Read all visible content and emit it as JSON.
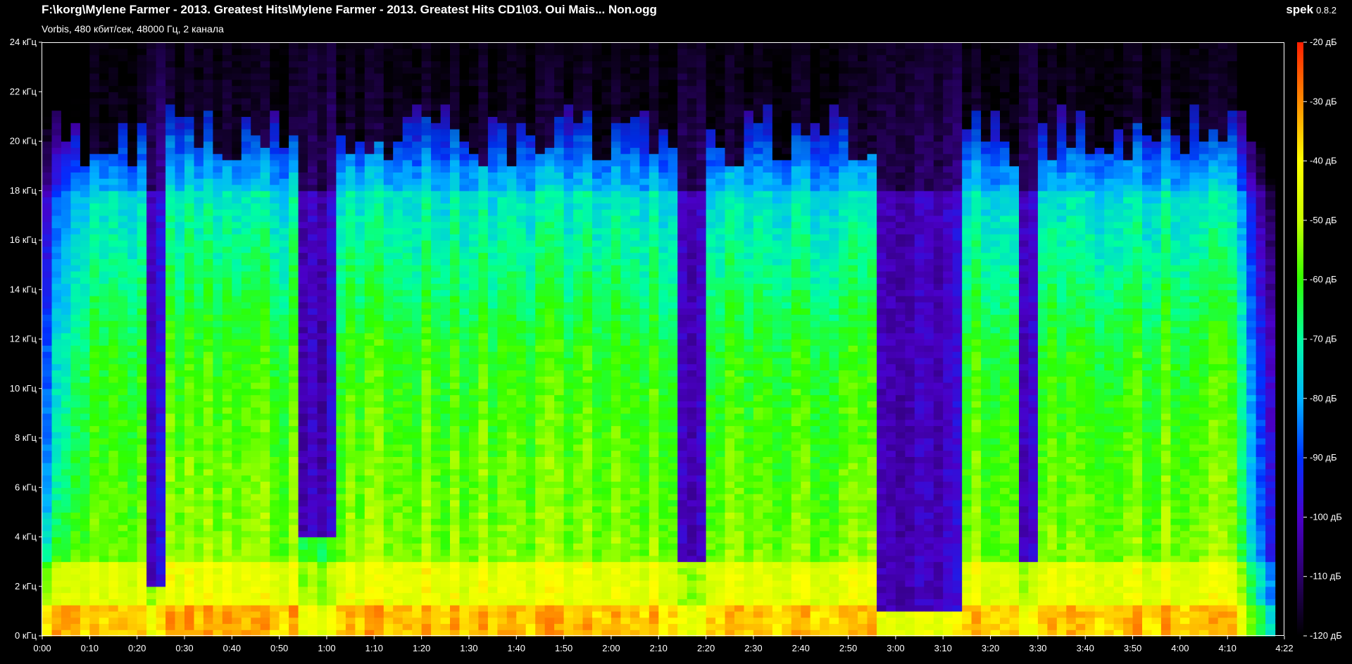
{
  "app": {
    "name": "spek",
    "version": "0.8.2"
  },
  "header": {
    "file_path": "F:\\korg\\Mylene Farmer - 2013. Greatest Hits\\Mylene Farmer - 2013. Greatest Hits CD1\\03. Oui Mais... Non.ogg",
    "file_info": "Vorbis, 480 кбит/сек, 48000 Гц, 2 канала"
  },
  "colors": {
    "background": "#000000",
    "axis": "#ffffff",
    "palette": [
      "#000000",
      "#2a0066",
      "#4a00c8",
      "#0030ff",
      "#00b4ff",
      "#00ffa0",
      "#30ff00",
      "#c8ff00",
      "#ffff00",
      "#ff8c00",
      "#ff1e00"
    ]
  },
  "chart_data": {
    "type": "heatmap",
    "title": "F:\\korg\\Mylene Farmer - 2013. Greatest Hits\\Mylene Farmer - 2013. Greatest Hits CD1\\03. Oui Mais... Non.ogg",
    "subtitle": "Vorbis, 480 кбит/сек, 48000 Гц, 2 канала",
    "x_ticks": [
      "0:00",
      "0:10",
      "0:20",
      "0:30",
      "0:40",
      "0:50",
      "1:00",
      "1:10",
      "1:20",
      "1:30",
      "1:40",
      "1:50",
      "2:00",
      "2:10",
      "2:20",
      "2:30",
      "2:40",
      "2:50",
      "3:00",
      "3:10",
      "3:20",
      "3:30",
      "3:40",
      "3:50",
      "4:00",
      "4:10",
      "4:22"
    ],
    "x_tick_seconds": [
      0,
      10,
      20,
      30,
      40,
      50,
      60,
      70,
      80,
      90,
      100,
      110,
      120,
      130,
      140,
      150,
      160,
      170,
      180,
      190,
      200,
      210,
      220,
      230,
      240,
      250,
      262
    ],
    "xlim": [
      0,
      262
    ],
    "y_ticks": [
      "0 кГц",
      "2 кГц",
      "4 кГц",
      "6 кГц",
      "8 кГц",
      "10 кГц",
      "12 кГц",
      "14 кГц",
      "16 кГц",
      "18 кГц",
      "20 кГц",
      "22 кГц",
      "24 кГц"
    ],
    "y_tick_values_khz": [
      0,
      2,
      4,
      6,
      8,
      10,
      12,
      14,
      16,
      18,
      20,
      22,
      24
    ],
    "ylim": [
      0,
      24
    ],
    "colorbar_ticks": [
      "-20 дБ",
      "-30 дБ",
      "-40 дБ",
      "-50 дБ",
      "-60 дБ",
      "-70 дБ",
      "-80 дБ",
      "-90 дБ",
      "-100 дБ",
      "-110 дБ",
      "-120 дБ"
    ],
    "colorbar_tick_values_db": [
      -20,
      -30,
      -40,
      -50,
      -60,
      -70,
      -80,
      -90,
      -100,
      -110,
      -120
    ],
    "colorbar_range_db": [
      -120,
      -20
    ],
    "track_end_seconds": 259,
    "quiet_dips": [
      {
        "start_s": 22.5,
        "end_s": 25,
        "floor_khz": 2
      },
      {
        "start_s": 55,
        "end_s": 61,
        "floor_khz": 4
      },
      {
        "start_s": 134,
        "end_s": 140,
        "floor_khz": 3
      },
      {
        "start_s": 177,
        "end_s": 193,
        "floor_khz": 1
      },
      {
        "start_s": 206,
        "end_s": 210,
        "floor_khz": 3
      }
    ]
  }
}
